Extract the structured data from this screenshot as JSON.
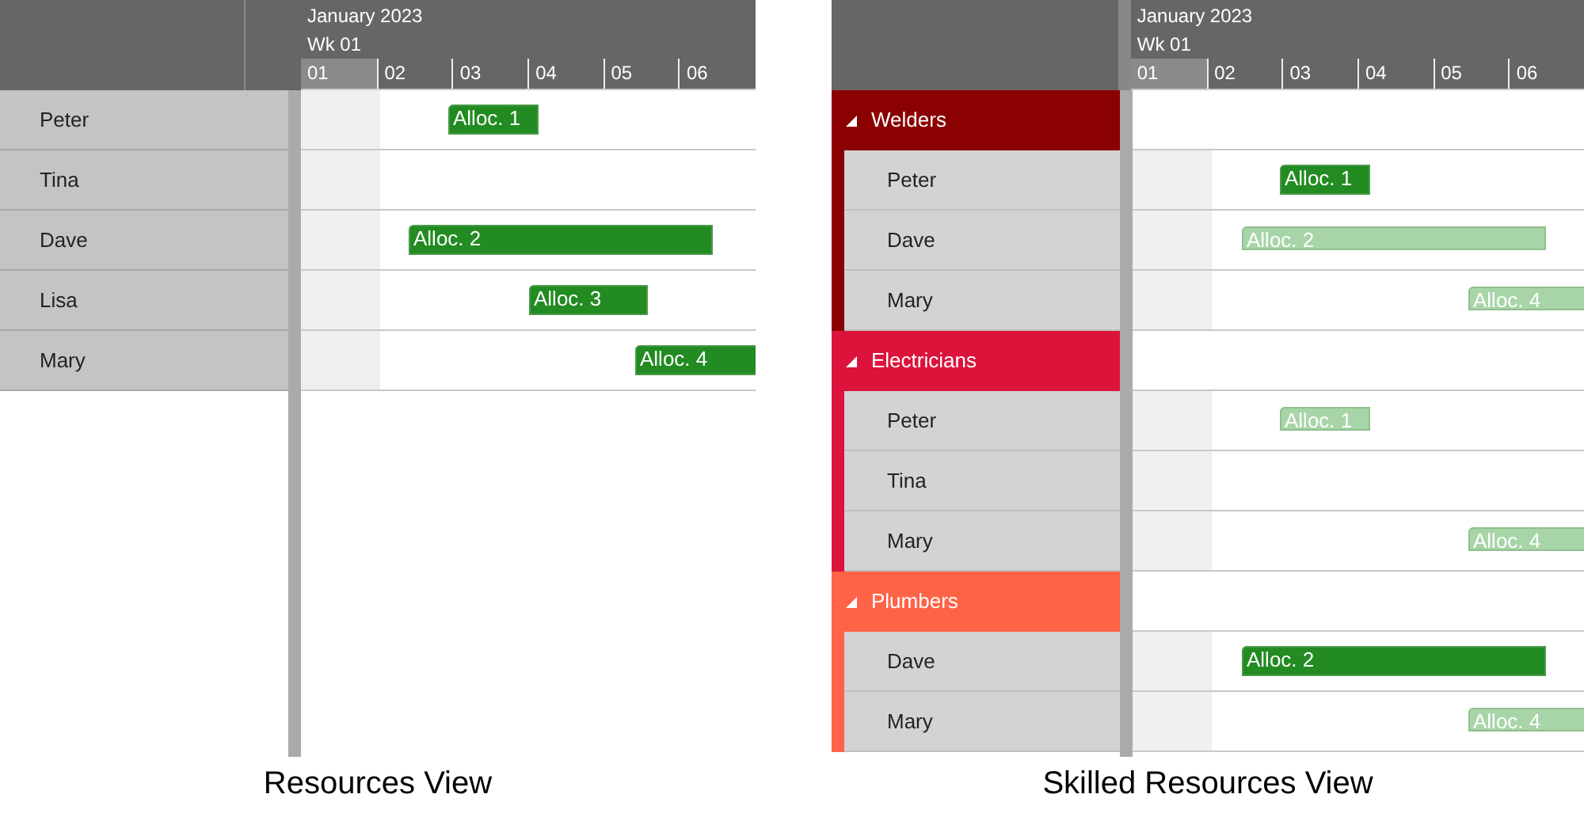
{
  "views": [
    {
      "caption": "Resources View",
      "month": "January 2023",
      "week": "Wk 01",
      "days": [
        {
          "label": "01",
          "selected": true
        },
        {
          "label": "02",
          "selected": false
        },
        {
          "label": "03",
          "selected": false
        },
        {
          "label": "04",
          "selected": false
        },
        {
          "label": "05",
          "selected": false
        },
        {
          "label": "06",
          "selected": false
        }
      ],
      "rows": [
        {
          "kind": "resource",
          "name": "Peter",
          "allocation": {
            "label": "Alloc. 1",
            "faded": false
          }
        },
        {
          "kind": "resource",
          "name": "Tina"
        },
        {
          "kind": "resource",
          "name": "Dave",
          "allocation": {
            "label": "Alloc. 2",
            "faded": false
          }
        },
        {
          "kind": "resource",
          "name": "Lisa",
          "allocation": {
            "label": "Alloc. 3",
            "faded": false
          }
        },
        {
          "kind": "resource",
          "name": "Mary",
          "allocation": {
            "label": "Alloc. 4",
            "faded": false
          }
        }
      ]
    },
    {
      "caption": "Skilled Resources View",
      "month": "January 2023",
      "week": "Wk 01",
      "days": [
        {
          "label": "01",
          "selected": true
        },
        {
          "label": "02",
          "selected": false
        },
        {
          "label": "03",
          "selected": false
        },
        {
          "label": "04",
          "selected": false
        },
        {
          "label": "05",
          "selected": false
        },
        {
          "label": "06",
          "selected": false
        }
      ],
      "rows": [
        {
          "kind": "group",
          "name": "Welders",
          "color": "#8b0000",
          "expanded": true,
          "children": [
            {
              "kind": "resource",
              "name": "Peter",
              "allocation": {
                "label": "Alloc. 1",
                "faded": false
              }
            },
            {
              "kind": "resource",
              "name": "Dave",
              "allocation": {
                "label": "Alloc. 2",
                "faded": true
              }
            },
            {
              "kind": "resource",
              "name": "Mary",
              "allocation": {
                "label": "Alloc. 4",
                "faded": true
              }
            }
          ]
        },
        {
          "kind": "group",
          "name": "Electricians",
          "color": "#dc143c",
          "expanded": true,
          "children": [
            {
              "kind": "resource",
              "name": "Peter",
              "allocation": {
                "label": "Alloc. 1",
                "faded": true
              }
            },
            {
              "kind": "resource",
              "name": "Tina"
            },
            {
              "kind": "resource",
              "name": "Mary",
              "allocation": {
                "label": "Alloc. 4",
                "faded": true
              }
            }
          ]
        },
        {
          "kind": "group",
          "name": "Plumbers",
          "color": "#ff6347",
          "expanded": true,
          "children": [
            {
              "kind": "resource",
              "name": "Dave",
              "allocation": {
                "label": "Alloc. 2",
                "faded": false
              }
            },
            {
              "kind": "resource",
              "name": "Mary",
              "allocation": {
                "label": "Alloc. 4",
                "faded": true
              }
            }
          ]
        }
      ]
    }
  ]
}
